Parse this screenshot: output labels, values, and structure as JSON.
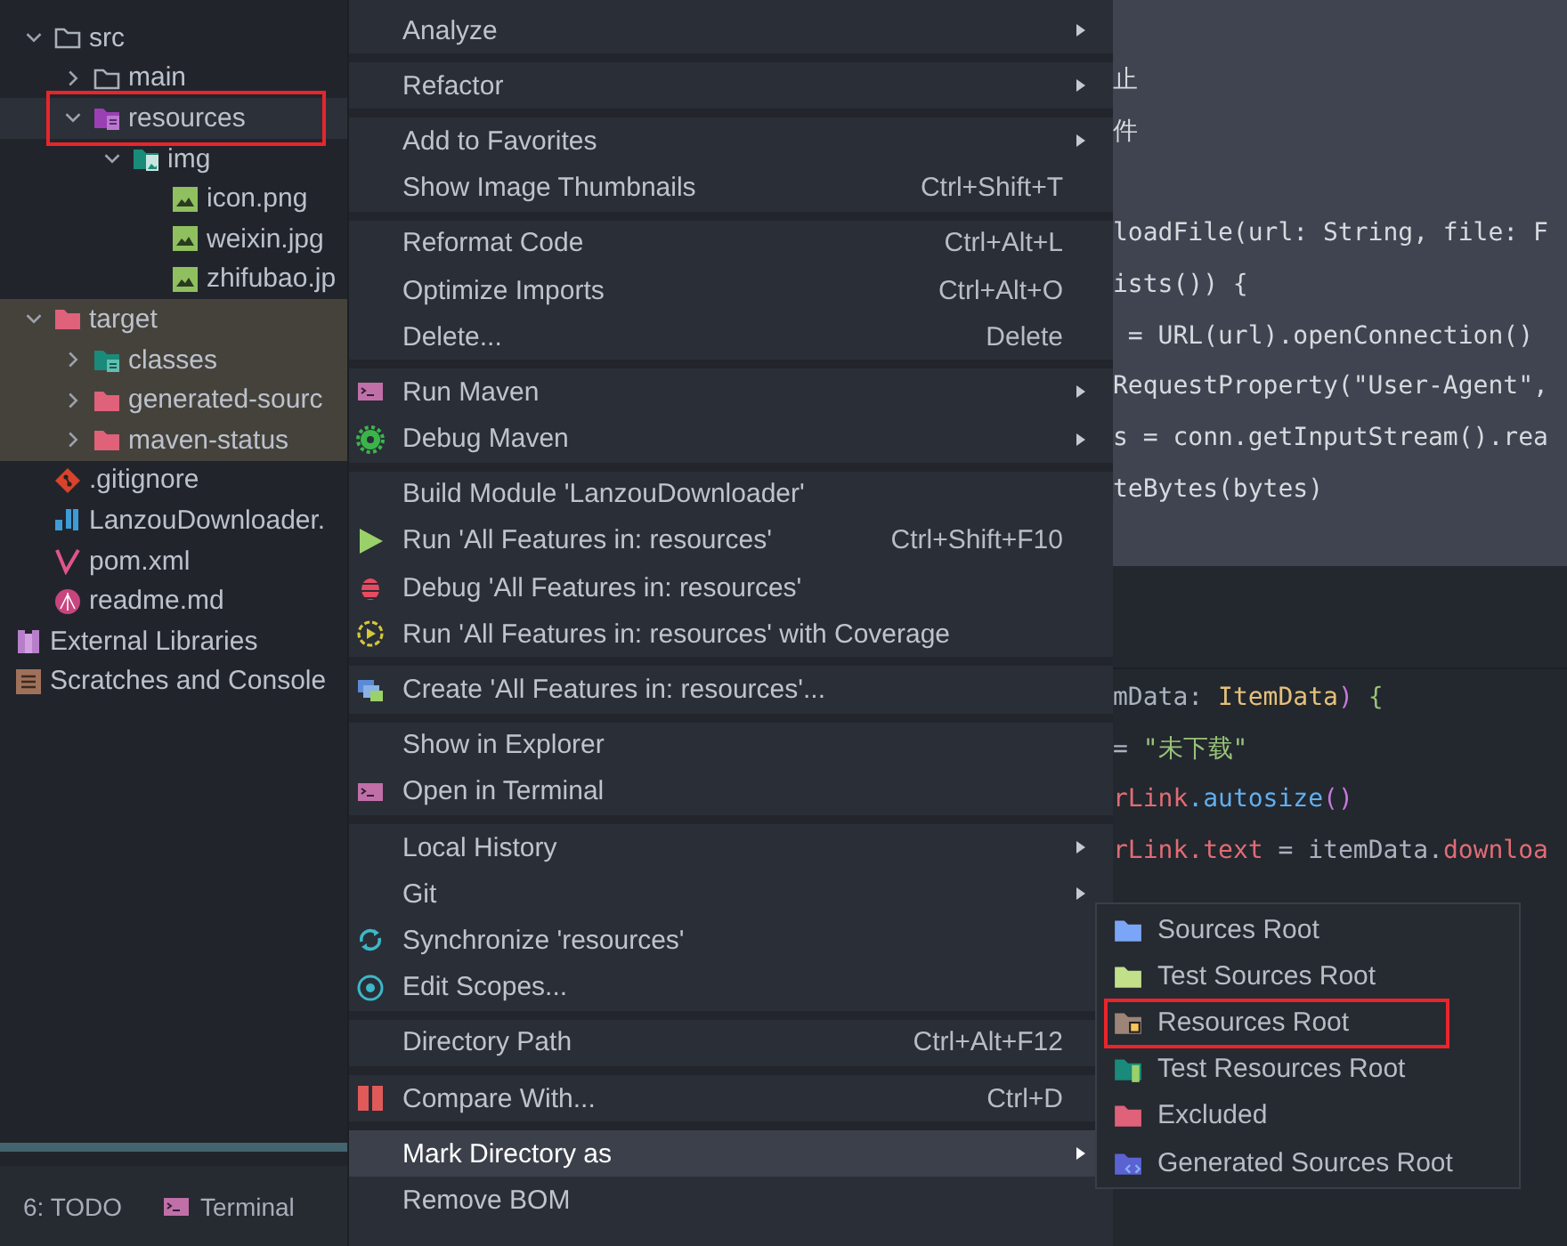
{
  "project_tree": {
    "items": [
      {
        "label": "src",
        "kind": "folder",
        "expanded": true,
        "selected": false,
        "excluded": false,
        "annotated": false,
        "children": [
          {
            "label": "main",
            "kind": "folder",
            "expanded": false,
            "selected": false,
            "excluded": false,
            "annotated": false
          },
          {
            "label": "resources",
            "kind": "res-folder",
            "expanded": true,
            "selected": true,
            "excluded": false,
            "annotated": true,
            "children": [
              {
                "label": "img",
                "kind": "img-folder",
                "expanded": true,
                "selected": false,
                "excluded": false,
                "annotated": false,
                "children": [
                  {
                    "label": "icon.png",
                    "kind": "image",
                    "selected": false,
                    "excluded": false,
                    "annotated": false
                  },
                  {
                    "label": "weixin.jpg",
                    "kind": "image",
                    "selected": false,
                    "excluded": false,
                    "annotated": false
                  },
                  {
                    "label": "zhifubao.jp",
                    "kind": "image",
                    "selected": false,
                    "excluded": false,
                    "annotated": false
                  }
                ]
              }
            ]
          }
        ]
      },
      {
        "label": "target",
        "kind": "excluded-folder",
        "expanded": true,
        "selected": false,
        "excluded": true,
        "annotated": false,
        "children": [
          {
            "label": "classes",
            "kind": "classes-folder",
            "expanded": false,
            "selected": false,
            "excluded": true,
            "annotated": false
          },
          {
            "label": "generated-sourc",
            "kind": "excluded-folder",
            "expanded": false,
            "selected": false,
            "excluded": true,
            "annotated": false
          },
          {
            "label": "maven-status",
            "kind": "excluded-folder",
            "expanded": false,
            "selected": false,
            "excluded": true,
            "annotated": false
          }
        ]
      },
      {
        "label": ".gitignore",
        "kind": "git",
        "selected": false,
        "excluded": false,
        "annotated": false
      },
      {
        "label": "LanzouDownloader.",
        "kind": "module",
        "selected": false,
        "excluded": false,
        "annotated": false
      },
      {
        "label": "pom.xml",
        "kind": "maven",
        "selected": false,
        "excluded": false,
        "annotated": false
      },
      {
        "label": "readme.md",
        "kind": "markdown",
        "selected": false,
        "excluded": false,
        "annotated": false
      },
      {
        "label": "External Libraries",
        "kind": "library",
        "selected": false,
        "excluded": false,
        "annotated": false
      },
      {
        "label": "Scratches and Console",
        "kind": "scratch",
        "selected": false,
        "excluded": false,
        "annotated": false
      }
    ]
  },
  "bottom_toolbar": {
    "items": [
      {
        "label": "6: TODO",
        "kind": "plain"
      },
      {
        "label": "Terminal",
        "kind": "terminal"
      }
    ]
  },
  "context_menu": {
    "groups": [
      [
        {
          "label": "Analyze",
          "submenu": true,
          "selected": false
        }
      ],
      [
        {
          "label": "Refactor",
          "submenu": true,
          "selected": false
        }
      ],
      [
        {
          "label": "Add to Favorites",
          "submenu": true,
          "selected": false
        },
        {
          "label": "Show Image Thumbnails",
          "shortcut": "Ctrl+Shift+T",
          "selected": false
        }
      ],
      [
        {
          "label": "Reformat Code",
          "shortcut": "Ctrl+Alt+L",
          "selected": false
        },
        {
          "label": "Optimize Imports",
          "shortcut": "Ctrl+Alt+O",
          "selected": false
        },
        {
          "label": "Delete...",
          "shortcut": "Delete",
          "selected": false
        }
      ],
      [
        {
          "label": "Run Maven",
          "kind": "terminal",
          "submenu": true,
          "selected": false
        },
        {
          "label": "Debug Maven",
          "kind": "gear",
          "submenu": true,
          "selected": false
        }
      ],
      [
        {
          "label": "Build Module 'LanzouDownloader'",
          "selected": false
        },
        {
          "label": "Run 'All Features in: resources'",
          "kind": "play",
          "shortcut": "Ctrl+Shift+F10",
          "selected": false
        },
        {
          "label": "Debug 'All Features in: resources'",
          "kind": "bug",
          "selected": false
        },
        {
          "label": "Run 'All Features in: resources' with Coverage",
          "kind": "coverage",
          "selected": false
        }
      ],
      [
        {
          "label": "Create 'All Features in: resources'...",
          "kind": "create",
          "selected": false
        }
      ],
      [
        {
          "label": "Show in Explorer",
          "selected": false
        },
        {
          "label": "Open in Terminal",
          "kind": "terminal",
          "selected": false
        }
      ],
      [
        {
          "label": "Local History",
          "submenu": true,
          "selected": false
        },
        {
          "label": "Git",
          "submenu": true,
          "selected": false
        },
        {
          "label": "Synchronize 'resources'",
          "kind": "sync",
          "selected": false
        },
        {
          "label": "Edit Scopes...",
          "kind": "scope",
          "selected": false
        }
      ],
      [
        {
          "label": "Directory Path",
          "shortcut": "Ctrl+Alt+F12",
          "selected": false
        }
      ],
      [
        {
          "label": "Compare With...",
          "kind": "compare",
          "shortcut": "Ctrl+D",
          "selected": false
        }
      ],
      [
        {
          "label": "Mark Directory as",
          "submenu": true,
          "selected": true
        },
        {
          "label": "Remove BOM",
          "selected": false
        }
      ]
    ]
  },
  "submenu": {
    "items": [
      {
        "label": "Sources Root",
        "kind": "sources",
        "annotated": false
      },
      {
        "label": "Test Sources Root",
        "kind": "test-sources",
        "annotated": false
      },
      {
        "label": "Resources Root",
        "kind": "resources",
        "annotated": true
      },
      {
        "label": "Test Resources Root",
        "kind": "test-resources",
        "annotated": false
      },
      {
        "label": "Excluded",
        "kind": "excluded",
        "annotated": false
      },
      {
        "label": "Generated Sources Root",
        "kind": "generated",
        "annotated": false
      }
    ]
  },
  "editor": {
    "doc_comment": [
      [
        {
          "text": "止",
          "kind": "plain"
        }
      ],
      [
        {
          "text": "件",
          "kind": "plain"
        }
      ]
    ],
    "doc_code": [
      [
        {
          "text": "loadFile(url: String, file: F",
          "kind": "plain"
        }
      ],
      [
        {
          "text": "ists()) {",
          "kind": "plain"
        }
      ],
      [
        {
          "text": " = URL(url).openConnection()",
          "kind": "plain"
        }
      ],
      [
        {
          "text": "RequestProperty(\"User-Agent\",",
          "kind": "plain"
        }
      ],
      [
        {
          "text": "s = conn.getInputStream().rea",
          "kind": "plain"
        }
      ],
      [
        {
          "text": "teBytes(bytes)",
          "kind": "plain"
        }
      ]
    ],
    "code_lines": [
      [
        {
          "text": "mData: ",
          "kind": "plain"
        },
        {
          "text": "ItemData",
          "kind": "type"
        },
        {
          "text": ")",
          "kind": "paren"
        },
        {
          "text": " {",
          "kind": "brace"
        }
      ],
      [
        {
          "text": "= ",
          "kind": "plain"
        },
        {
          "text": "\"未下载\"",
          "kind": "string"
        }
      ],
      [
        {
          "text": "rLink",
          "kind": "field"
        },
        {
          "text": ".autosize",
          "kind": "method"
        },
        {
          "text": "()",
          "kind": "paren"
        }
      ],
      [
        {
          "text": "rLink",
          "kind": "field"
        },
        {
          "text": ".text",
          "kind": "field"
        },
        {
          "text": " = itemData.",
          "kind": "plain"
        },
        {
          "text": "downloa",
          "kind": "field"
        }
      ]
    ]
  }
}
